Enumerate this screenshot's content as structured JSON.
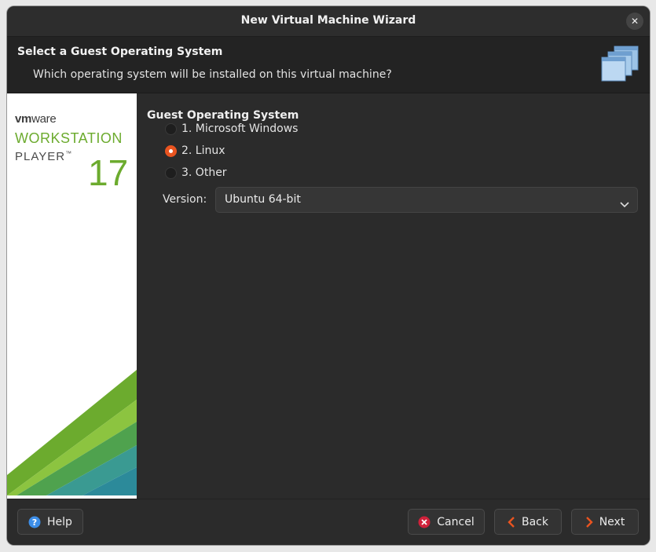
{
  "window": {
    "title": "New Virtual Machine Wizard"
  },
  "header": {
    "title": "Select a Guest Operating System",
    "subtitle": "Which operating system will be installed on this virtual machine?"
  },
  "brand": {
    "vm": "vm",
    "ware": "ware",
    "product": "WORKSTATION",
    "edition": "PLAYER",
    "tm": "™",
    "version": "17",
    "accent_color": "#6cab2e"
  },
  "guest_os": {
    "section_label": "Guest Operating System",
    "options": [
      {
        "label": "1. Microsoft Windows",
        "selected": false
      },
      {
        "label": "2. Linux",
        "selected": true
      },
      {
        "label": "3. Other",
        "selected": false
      }
    ],
    "version_label": "Version:",
    "version_value": "Ubuntu 64-bit"
  },
  "footer": {
    "help": "Help",
    "cancel": "Cancel",
    "back": "Back",
    "next": "Next"
  },
  "colors": {
    "radio_selected": "#e95420",
    "help_icon": "#3d8ee8",
    "cancel_icon": "#d0213a",
    "nav_arrow": "#e95420"
  },
  "icons": {
    "close": "close-icon",
    "header": "virtual-machines-icon",
    "dropdown": "chevron-down-icon",
    "help": "help-icon",
    "cancel": "cancel-icon",
    "back": "chevron-left-icon",
    "next": "chevron-right-icon"
  }
}
